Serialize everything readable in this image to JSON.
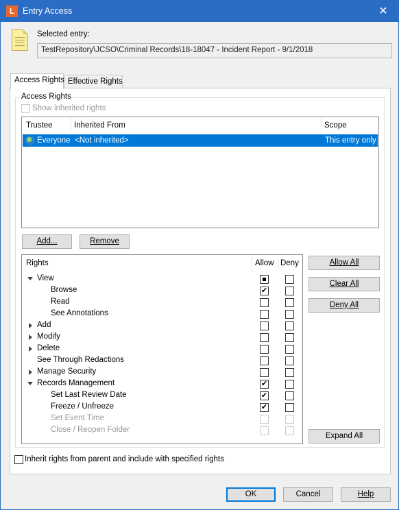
{
  "window": {
    "title": "Entry Access",
    "app_icon_letter": "L",
    "close_glyph": "✕"
  },
  "selected_entry": {
    "label": "Selected entry:",
    "path": "TestRepository\\JCSO\\Criminal Records\\18-18047 - Incident Report - 9/1/2018"
  },
  "tabs": [
    {
      "label": "Access Rights",
      "active": true
    },
    {
      "label": "Effective Rights",
      "active": false
    }
  ],
  "access_rights": {
    "group_label": "Access Rights",
    "show_inherited_label": "Show inherited rights",
    "show_inherited_checked": false,
    "columns": [
      "Trustee",
      "Inherited From",
      "Scope"
    ],
    "rows": [
      {
        "trustee": "Everyone",
        "inherited_from": "<Not inherited>",
        "scope": "This entry only",
        "selected": true,
        "icon": "globe-icon"
      }
    ],
    "add_label": "Add...",
    "remove_label": "Remove"
  },
  "rights": {
    "columns": {
      "rights": "Rights",
      "allow": "Allow",
      "deny": "Deny"
    },
    "items": [
      {
        "label": "View",
        "level": 0,
        "expander": "expanded",
        "allow": "indeterminate",
        "deny": "unchecked",
        "enabled": true
      },
      {
        "label": "Browse",
        "level": 1,
        "expander": "none",
        "allow": "checked",
        "deny": "unchecked",
        "enabled": true
      },
      {
        "label": "Read",
        "level": 1,
        "expander": "none",
        "allow": "unchecked",
        "deny": "unchecked",
        "enabled": true
      },
      {
        "label": "See Annotations",
        "level": 1,
        "expander": "none",
        "allow": "unchecked",
        "deny": "unchecked",
        "enabled": true
      },
      {
        "label": "Add",
        "level": 0,
        "expander": "collapsed",
        "allow": "unchecked",
        "deny": "unchecked",
        "enabled": true
      },
      {
        "label": "Modify",
        "level": 0,
        "expander": "collapsed",
        "allow": "unchecked",
        "deny": "unchecked",
        "enabled": true
      },
      {
        "label": "Delete",
        "level": 0,
        "expander": "collapsed",
        "allow": "unchecked",
        "deny": "unchecked",
        "enabled": true
      },
      {
        "label": "See Through Redactions",
        "level": 0,
        "expander": "none",
        "allow": "unchecked",
        "deny": "unchecked",
        "enabled": true
      },
      {
        "label": "Manage Security",
        "level": 0,
        "expander": "collapsed",
        "allow": "unchecked",
        "deny": "unchecked",
        "enabled": true
      },
      {
        "label": "Records Management",
        "level": 0,
        "expander": "expanded",
        "allow": "checked",
        "deny": "unchecked",
        "enabled": true
      },
      {
        "label": "Set Last Review Date",
        "level": 1,
        "expander": "none",
        "allow": "checked",
        "deny": "unchecked",
        "enabled": true
      },
      {
        "label": "Freeze / Unfreeze",
        "level": 1,
        "expander": "none",
        "allow": "checked",
        "deny": "unchecked",
        "enabled": true
      },
      {
        "label": "Set Event Time",
        "level": 1,
        "expander": "none",
        "allow": "unchecked",
        "deny": "unchecked",
        "enabled": false
      },
      {
        "label": "Close / Reopen Folder",
        "level": 1,
        "expander": "none",
        "allow": "unchecked",
        "deny": "unchecked",
        "enabled": false
      }
    ],
    "allow_all_label": "Allow All",
    "clear_all_label": "Clear All",
    "deny_all_label": "Deny All",
    "expand_all_label": "Expand All"
  },
  "inherit": {
    "label": "Inherit rights from parent and include with specified rights",
    "checked": false
  },
  "footer": {
    "ok_label": "OK",
    "cancel_label": "Cancel",
    "help_label": "Help"
  },
  "colors": {
    "title_bar": "#2b6cc4",
    "selection": "#0078d7",
    "app_icon": "#e8662b"
  }
}
